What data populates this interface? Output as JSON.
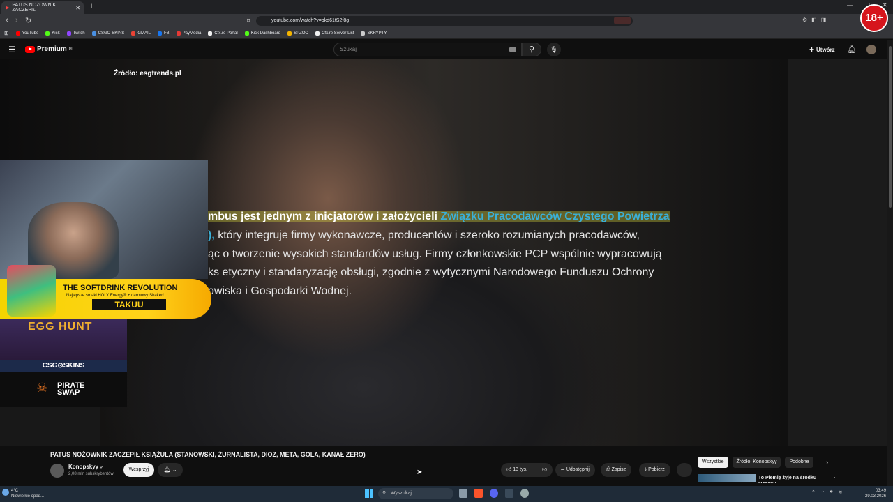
{
  "browser": {
    "tab_title": "PATUS NOŻOWNIK ZACZEPIŁ",
    "tab_close": "✕",
    "new_tab": "+",
    "url": "youtube.com/watch?v=bkd61tS2f8g",
    "window_controls": [
      "—",
      "□",
      "✕"
    ],
    "bookmarks": [
      {
        "label": "YouTube",
        "color": "#ff0000"
      },
      {
        "label": "Kick",
        "color": "#53fc18"
      },
      {
        "label": "Twitch",
        "color": "#9146ff"
      },
      {
        "label": "CSGO-SKINS",
        "color": "#4a90e2"
      },
      {
        "label": "GMAIL",
        "color": "#ea4335"
      },
      {
        "label": "FB",
        "color": "#1877f2"
      },
      {
        "label": "PayMedia",
        "color": "#e53935"
      },
      {
        "label": "Cfx.re Portal",
        "color": "#f0f0f0"
      },
      {
        "label": "Kick Dashboard",
        "color": "#53fc18"
      },
      {
        "label": "SPZOO",
        "color": "#f4b400"
      },
      {
        "label": "Cfx.re Server List",
        "color": "#f0f0f0"
      },
      {
        "label": "SKRYPTY",
        "color": "#cccccc"
      }
    ]
  },
  "youtube": {
    "logo_text": "Premium",
    "logo_sup": "PL",
    "search_placeholder": "Szukaj",
    "create_label": "Utwórz",
    "badge": "18+"
  },
  "video": {
    "source_caption": "Źródło: esgtrends.pl",
    "subtitle_lines": [
      {
        "pre": "mbus jest jednym z inicjatorów i założycieli ",
        "link": "Związku Pracodawców Czystego Powietrza"
      },
      {
        "pre": "), ",
        "text": "który integruje firmy wykonawcze, producentów i szeroko rozumianych pracodawców,"
      },
      {
        "text": "ąc o tworzenie wysokich standardów usług. Firmy członkowskie PCP wspólnie wypracowują"
      },
      {
        "text": "ks etyczny i standaryzację obsługi, zgodnie z wytycznymi Narodowego Funduszu Ochrony"
      },
      {
        "text": "owiska i Gospodarki Wodnej."
      }
    ],
    "overlays": {
      "promo_title": "THE SOFTDRINK REVOLUTION",
      "promo_sub": "Najlepsze smaki HOLY Energy® + darmowy Shaker!",
      "promo_brand": "TAKUU",
      "egg_hunt": "EGG HUNT",
      "csg_skins": "CSG⊙SKINS",
      "pirate_swap": "PIRATE SWAP"
    }
  },
  "below": {
    "title": "PATUS NOŻOWNIK ZACZEPIŁ KSIĄŻULA (STANOWSKI, ŻURNALISTA, DIOZ, META, GOLA, KANAŁ ZERO)",
    "channel_name": "Konopskyy",
    "subscribers": "2,08 mln subskrybentów",
    "support_label": "Wesprzyj",
    "likes": "13 tys.",
    "share": "Udostępnij",
    "save": "Zapisz",
    "download": "Pobierz",
    "chips": [
      "Wszystkie",
      "Źródło: Konopskyy",
      "Podobne"
    ],
    "rec_title": "To Plemię żyje na środku Oceanu"
  },
  "taskbar": {
    "weather_temp": "4°C",
    "weather_desc": "Niewielkie opad...",
    "search": "Wyszukaj",
    "time": "03:49",
    "date": "29.03.2026"
  }
}
